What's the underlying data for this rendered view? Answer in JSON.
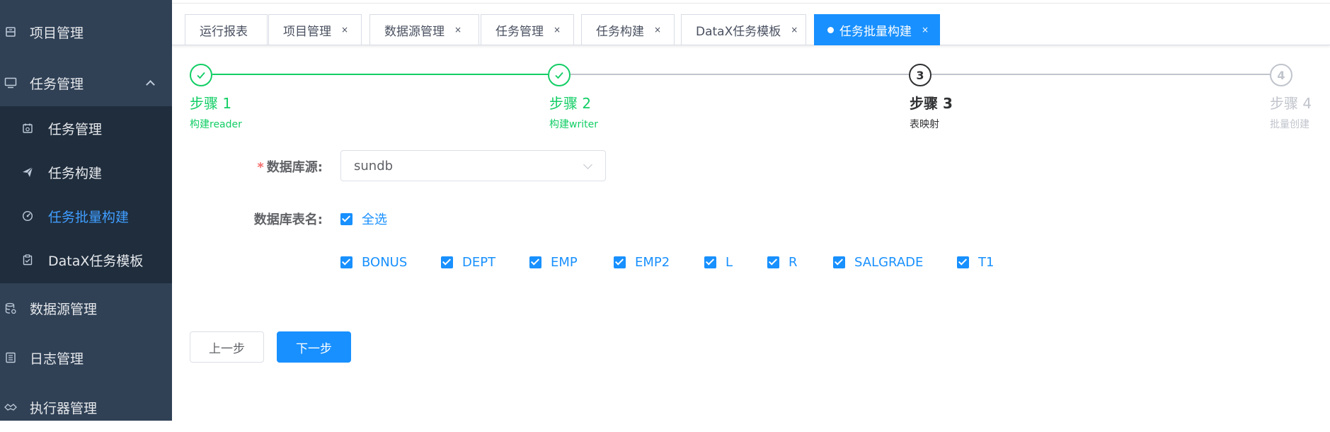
{
  "sidebar": {
    "items": [
      {
        "label": "项目管理",
        "icon": "project-icon"
      },
      {
        "label": "任务管理",
        "icon": "monitor-icon",
        "expanded": true
      },
      {
        "label": "数据源管理",
        "icon": "database-icon"
      },
      {
        "label": "日志管理",
        "icon": "log-icon"
      },
      {
        "label": "执行器管理",
        "icon": "executor-icon"
      }
    ],
    "submenu": [
      {
        "label": "任务管理",
        "icon": "calendar-icon"
      },
      {
        "label": "任务构建",
        "icon": "send-icon"
      },
      {
        "label": "任务批量构建",
        "icon": "dashboard-icon",
        "active": true
      },
      {
        "label": "DataX任务模板",
        "icon": "clipboard-icon"
      }
    ]
  },
  "tabs": [
    {
      "label": "运行报表",
      "closable": false
    },
    {
      "label": "项目管理",
      "closable": true
    },
    {
      "label": "数据源管理",
      "closable": true
    },
    {
      "label": "任务管理",
      "closable": true
    },
    {
      "label": "任务构建",
      "closable": true
    },
    {
      "label": "DataX任务模板",
      "closable": true
    },
    {
      "label": "任务批量构建",
      "closable": true,
      "active": true
    }
  ],
  "tab_close_glyph": "×",
  "steps": [
    {
      "number": "1",
      "title": "步骤 1",
      "description": "构建reader",
      "status": "finished"
    },
    {
      "number": "2",
      "title": "步骤 2",
      "description": "构建writer",
      "status": "finished"
    },
    {
      "number": "3",
      "title": "步骤 3",
      "description": "表映射",
      "status": "current"
    },
    {
      "number": "4",
      "title": "步骤 4",
      "description": "批量创建",
      "status": "pending"
    }
  ],
  "form": {
    "datasource_label": "数据库源:",
    "datasource_required_mark": "*",
    "datasource_value": "sundb",
    "table_label": "数据库表名:",
    "select_all_label": "全选",
    "tables": [
      "BONUS",
      "DEPT",
      "EMP",
      "EMP2",
      "L",
      "R",
      "SALGRADE",
      "T1"
    ]
  },
  "buttons": {
    "prev": "上一步",
    "next": "下一步"
  },
  "colors": {
    "sidebar_bg": "#304156",
    "submenu_bg": "#1f2d3d",
    "accent": "#1890ff",
    "success": "#13ce66"
  }
}
